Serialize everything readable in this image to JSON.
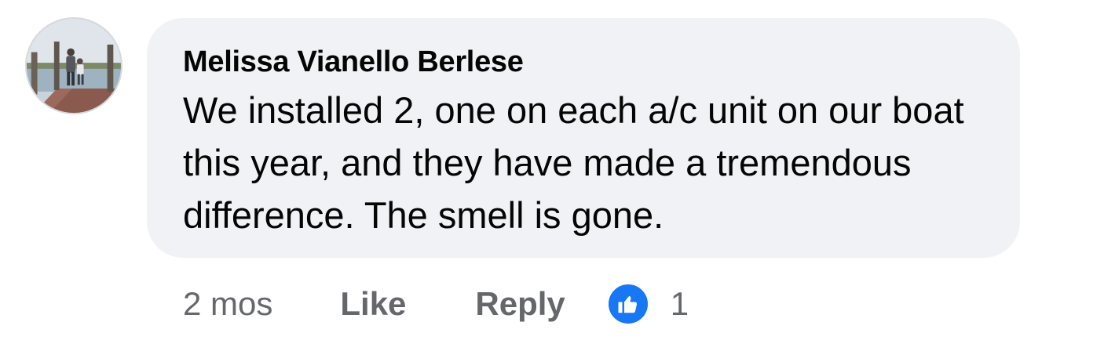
{
  "comment": {
    "author": "Melissa Vianello Berlese",
    "text": "We installed 2, one on each a/c unit on our boat this year, and they have made a tremendous difference. The smell is gone.",
    "timestamp": "2 mos",
    "like_label": "Like",
    "reply_label": "Reply",
    "reaction_count": "1",
    "reaction_icon": "thumbs-up-icon",
    "colors": {
      "bubble": "#f0f2f5",
      "action_text": "#65676b",
      "like_badge": "#1877f2"
    }
  }
}
